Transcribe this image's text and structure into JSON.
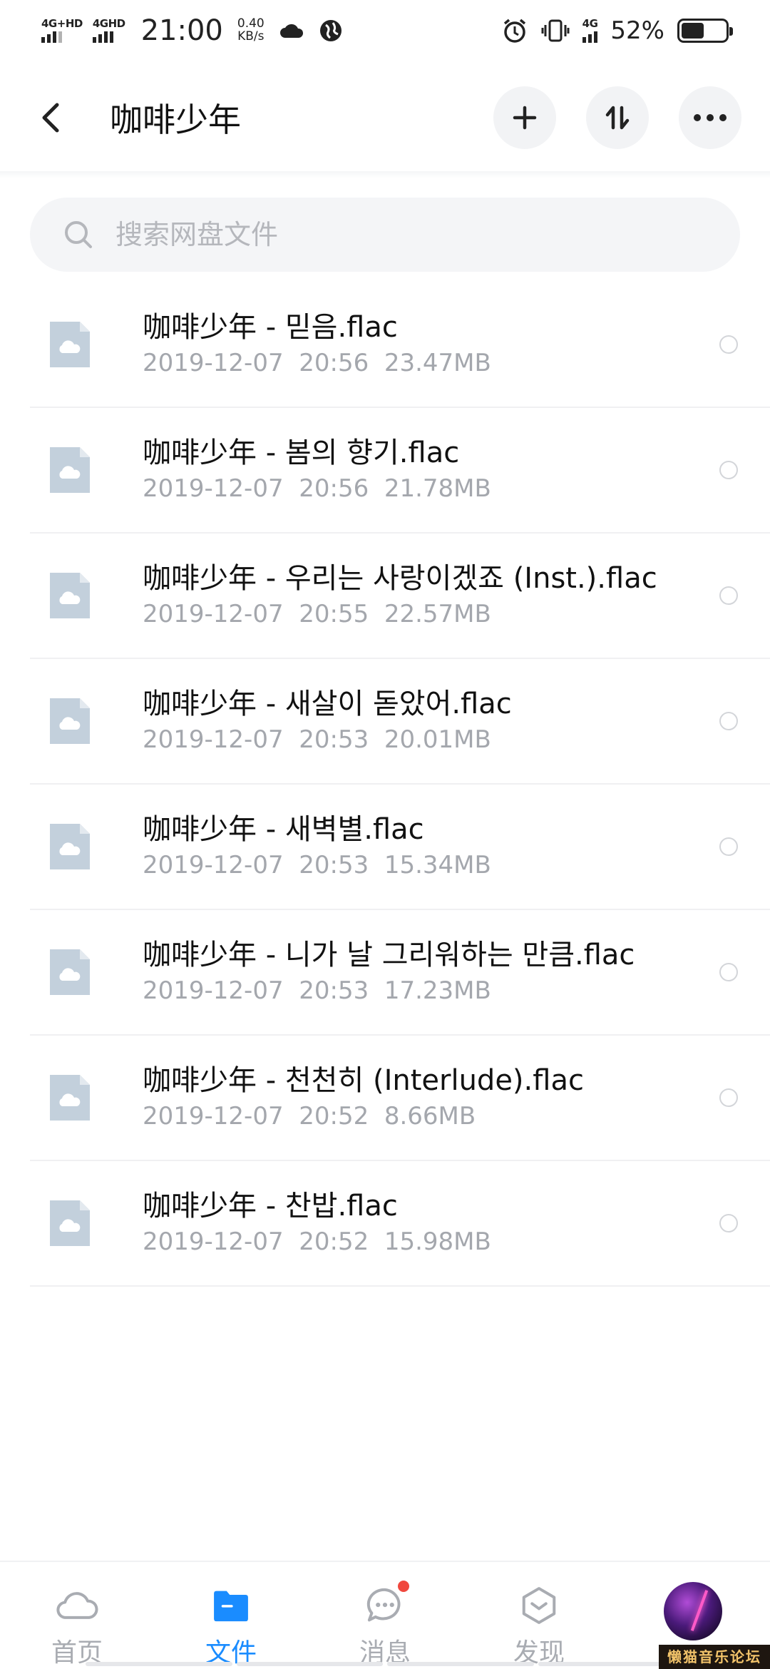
{
  "status_bar": {
    "network1": "4G+HD",
    "network2": "4GHD",
    "time": "21:00",
    "speed_value": "0.40",
    "speed_unit": "KB/s",
    "network3": "4G",
    "battery_text": "52%",
    "battery_level": 0.52
  },
  "header": {
    "title": "咖啡少年",
    "back_icon": "chevron-left-icon",
    "add_icon": "plus-icon",
    "sort_icon": "sort-icon",
    "more_icon": "more-icon"
  },
  "search": {
    "placeholder": "搜索网盘文件",
    "value": ""
  },
  "files": [
    {
      "name": "咖啡少年 - 믿음.flac",
      "date": "2019-12-07",
      "time": "20:56",
      "size": "23.47MB"
    },
    {
      "name": "咖啡少年 - 봄의 향기.flac",
      "date": "2019-12-07",
      "time": "20:56",
      "size": "21.78MB"
    },
    {
      "name": "咖啡少年 - 우리는 사랑이겠죠 (Inst.).flac",
      "date": "2019-12-07",
      "time": "20:55",
      "size": "22.57MB"
    },
    {
      "name": "咖啡少年 - 새살이 돋았어.flac",
      "date": "2019-12-07",
      "time": "20:53",
      "size": "20.01MB"
    },
    {
      "name": "咖啡少年 - 새벽별.flac",
      "date": "2019-12-07",
      "time": "20:53",
      "size": "15.34MB"
    },
    {
      "name": "咖啡少年 - 니가 날 그리워하는 만큼.flac",
      "date": "2019-12-07",
      "time": "20:53",
      "size": "17.23MB"
    },
    {
      "name": "咖啡少年 - 천천히 (Interlude).flac",
      "date": "2019-12-07",
      "time": "20:52",
      "size": "8.66MB"
    },
    {
      "name": "咖啡少年 - 찬밥.flac",
      "date": "2019-12-07",
      "time": "20:52",
      "size": "15.98MB"
    }
  ],
  "bottom_nav": [
    {
      "label": "首页",
      "icon": "cloud-icon",
      "active": false
    },
    {
      "label": "文件",
      "icon": "folder-icon",
      "active": true
    },
    {
      "label": "消息",
      "icon": "chat-icon",
      "active": false,
      "badge": true
    },
    {
      "label": "发现",
      "icon": "discover-icon",
      "active": false
    },
    {
      "label": "",
      "icon": "avatar",
      "active": false
    }
  ],
  "watermark": "懒猫音乐论坛",
  "colors": {
    "accent": "#1a8cff",
    "file_icon": "#c3d0dc",
    "meta_text": "#a4a7ad",
    "badge": "#f0483e"
  }
}
